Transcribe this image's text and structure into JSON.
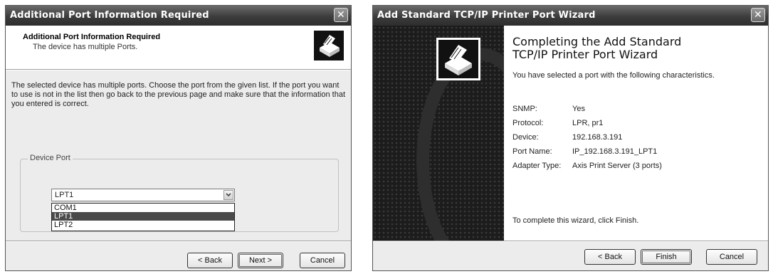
{
  "left_dialog": {
    "title": "Additional Port Information Required",
    "header_title": "Additional Port Information Required",
    "header_subtitle": "The device has multiple Ports.",
    "body_text": "The selected device has multiple ports.  Choose the port from the given list.  If the port you want to use is not in the list then go back to the previous page and make sure that the information that you entered is correct.",
    "group_label": "Device Port",
    "selected_port": "LPT1",
    "port_options": [
      "COM1",
      "LPT1",
      "LPT2"
    ],
    "highlighted_option": "LPT1",
    "back_label": "< Back",
    "next_label": "Next >",
    "cancel_label": "Cancel",
    "close_glyph": "✕"
  },
  "right_dialog": {
    "title": "Add Standard TCP/IP Printer Port Wizard",
    "heading_line1": "Completing the Add Standard",
    "heading_line2": "TCP/IP Printer Port Wizard",
    "intro": "You have selected a port with the following characteristics.",
    "details": [
      {
        "label": "SNMP:",
        "value": "Yes"
      },
      {
        "label": "Protocol:",
        "value": "LPR, pr1"
      },
      {
        "label": "Device:",
        "value": "192.168.3.191"
      },
      {
        "label": "Port Name:",
        "value": "IP_192.168.3.191_LPT1"
      },
      {
        "label": "Adapter Type:",
        "value": "Axis Print Server (3 ports)"
      }
    ],
    "finish_note": "To complete this wizard, click Finish.",
    "back_label": "< Back",
    "finish_label": "Finish",
    "cancel_label": "Cancel",
    "close_glyph": "✕"
  }
}
